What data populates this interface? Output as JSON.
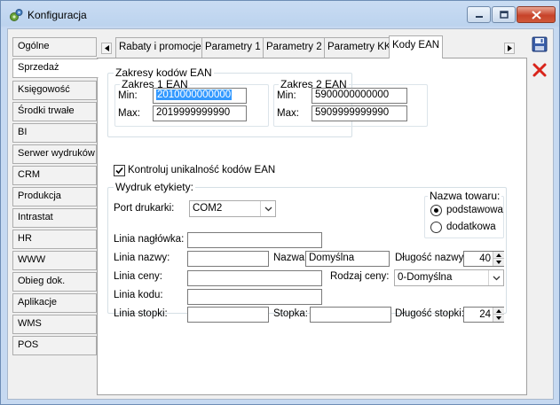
{
  "window": {
    "title": "Konfiguracja"
  },
  "sidebar": {
    "items": [
      {
        "label": "Ogólne"
      },
      {
        "label": "Sprzedaż"
      },
      {
        "label": "Księgowość"
      },
      {
        "label": "Środki trwałe"
      },
      {
        "label": "BI"
      },
      {
        "label": "Serwer wydruków"
      },
      {
        "label": "CRM"
      },
      {
        "label": "Produkcja"
      },
      {
        "label": "Intrastat"
      },
      {
        "label": "HR"
      },
      {
        "label": "WWW"
      },
      {
        "label": "Obieg dok."
      },
      {
        "label": "Aplikacje"
      },
      {
        "label": "WMS"
      },
      {
        "label": "POS"
      }
    ],
    "active": "Sprzedaż"
  },
  "tabs": {
    "items": [
      {
        "label": "Rabaty i promocje"
      },
      {
        "label": "Parametry 1"
      },
      {
        "label": "Parametry 2"
      },
      {
        "label": "Parametry KK"
      },
      {
        "label": "Kody EAN"
      }
    ],
    "active": "Kody EAN"
  },
  "ean": {
    "group_title": "Zakresy kodów EAN",
    "range1": {
      "title": "Zakres 1 EAN",
      "min_label": "Min:",
      "max_label": "Max:",
      "min": "2010000000000",
      "max": "2019999999990"
    },
    "range2": {
      "title": "Zakres 2 EAN",
      "min_label": "Min:",
      "max_label": "Max:",
      "min": "5900000000000",
      "max": "5909999999990"
    },
    "unique_check_label": "Kontroluj unikalność kodów EAN",
    "unique_check_checked": true
  },
  "print": {
    "group_title": "Wydruk etykiety:",
    "printer_port_label": "Port drukarki:",
    "printer_port_value": "COM2",
    "product_name": {
      "title": "Nazwa towaru:",
      "options": [
        {
          "label": "podstawowa",
          "selected": true
        },
        {
          "label": "dodatkowa",
          "selected": false
        }
      ]
    },
    "header_line_label": "Linia nagłówka:",
    "header_line_value": "",
    "name_line_label": "Linia nazwy:",
    "name_line_value": "",
    "name_label": "Nazwa:",
    "name_value": "Domyślna",
    "name_length_label": "Długość nazwy:",
    "name_length_value": "40",
    "price_line_label": "Linia ceny:",
    "price_line_value": "",
    "price_type_label": "Rodzaj ceny:",
    "price_type_value": "0-Domyślna",
    "code_line_label": "Linia kodu:",
    "code_line_value": "",
    "footer_line_label": "Linia stopki:",
    "footer_line_value": "",
    "footer_label": "Stopka:",
    "footer_value": "",
    "footer_length_label": "Długość stopki:",
    "footer_length_value": "24"
  },
  "colors": {
    "selection": "#3399ff",
    "delete_icon": "#d9241b",
    "save_icon": "#3b5fa8"
  }
}
